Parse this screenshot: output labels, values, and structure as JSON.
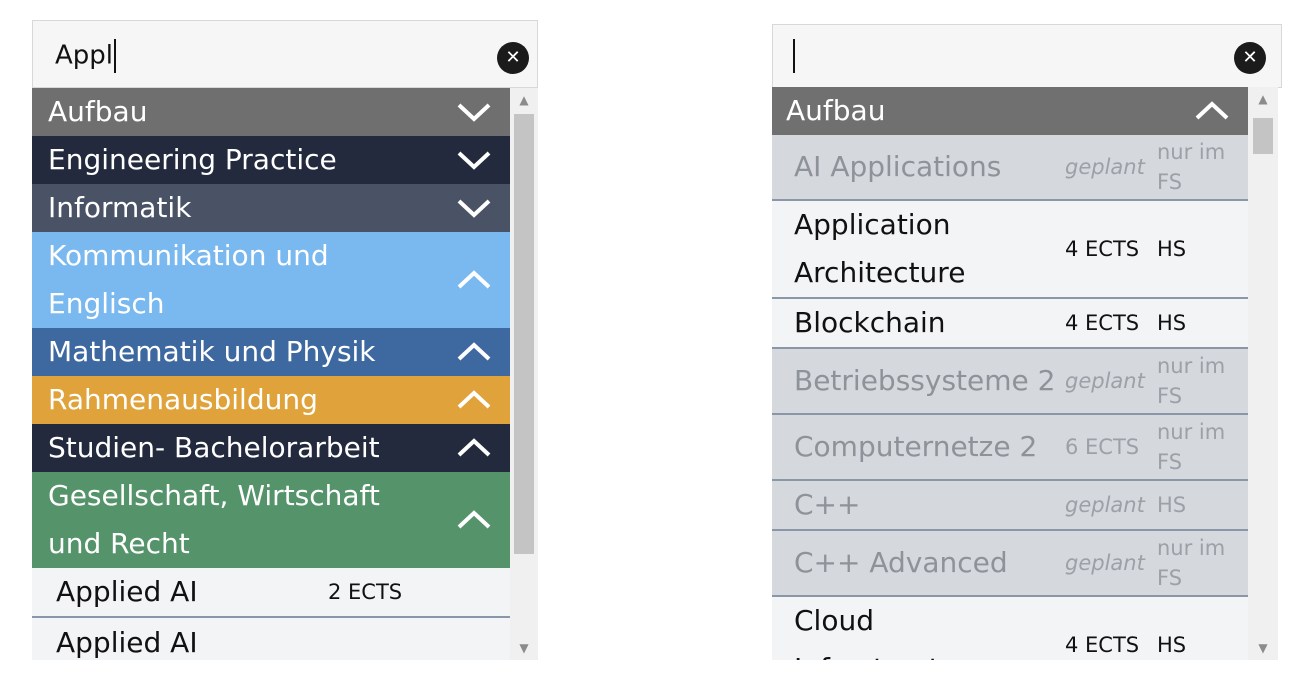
{
  "left": {
    "search_value": "Appl",
    "categories": [
      {
        "label": "Aufbau",
        "chevron": "chevron-down",
        "color": "#6f6f6f"
      },
      {
        "label": "Engineering Practice",
        "chevron": "chevron-down",
        "color": "#232a3d"
      },
      {
        "label": "Informatik",
        "chevron": "chevron-down",
        "color": "#4a5266"
      },
      {
        "label": "Kommunikation und Englisch",
        "chevron": "chevron-up",
        "color": "#7ab8f0"
      },
      {
        "label": "Mathematik und Physik",
        "chevron": "chevron-up",
        "color": "#3e68a0"
      },
      {
        "label": "Rahmenausbildung",
        "chevron": "chevron-up",
        "color": "#e0a23a"
      },
      {
        "label": "Studien- Bachelorarbeit",
        "chevron": "chevron-up",
        "color": "#232a3d"
      },
      {
        "label": "Gesellschaft, Wirtschaft und Recht",
        "chevron": "chevron-up",
        "color": "#55946b"
      }
    ],
    "courses": [
      {
        "name": "Applied AI",
        "ects": "2 ECTS",
        "sem": ""
      },
      {
        "name": "Applied AI",
        "ects": "",
        "sem": ""
      }
    ]
  },
  "right": {
    "search_value": "",
    "category": {
      "label": "Aufbau",
      "chevron": "chevron-up",
      "color": "#707070"
    },
    "courses": [
      {
        "name": "AI Applications",
        "ects": "geplant",
        "sem": "nur im FS",
        "state": "muted"
      },
      {
        "name": "Application Architecture",
        "ects": "4 ECTS",
        "sem": "HS",
        "state": "active"
      },
      {
        "name": "Blockchain",
        "ects": "4 ECTS",
        "sem": "HS",
        "state": "active"
      },
      {
        "name": "Betriebssysteme 2",
        "ects": "geplant",
        "sem": "nur im FS",
        "state": "muted"
      },
      {
        "name": "Computernetze 2",
        "ects": "6 ECTS",
        "sem": "nur im FS",
        "state": "muted"
      },
      {
        "name": "C++",
        "ects": "geplant",
        "sem": "HS",
        "state": "muted"
      },
      {
        "name": "C++ Advanced",
        "ects": "geplant",
        "sem": "nur im FS",
        "state": "muted"
      },
      {
        "name": "Cloud Infrastructure",
        "ects": "4 ECTS",
        "sem": "HS",
        "state": "active"
      }
    ]
  },
  "icons": {
    "clear": "close-circle-icon",
    "scroll_up": "scroll-up-arrow-icon",
    "scroll_down": "scroll-down-arrow-icon"
  }
}
